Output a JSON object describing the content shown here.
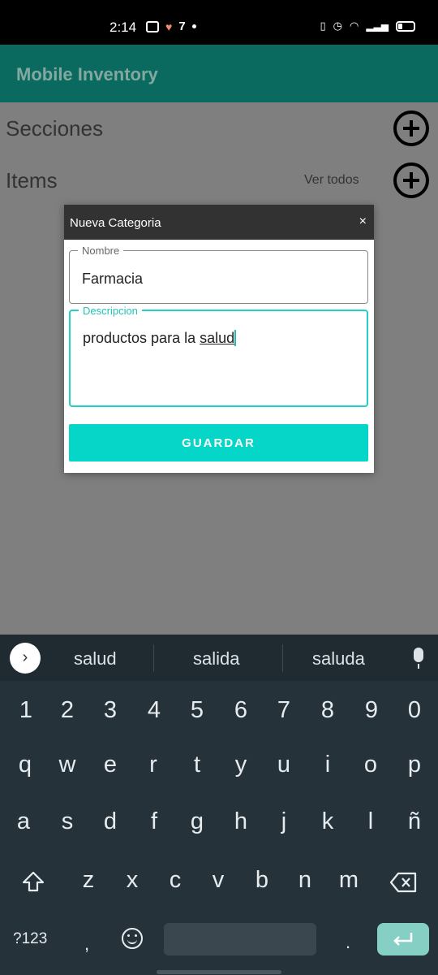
{
  "status_bar": {
    "time": "2:14"
  },
  "app": {
    "title": "Mobile Inventory",
    "sections_label": "Secciones",
    "items_label": "Items",
    "view_all": "Ver todos"
  },
  "dialog": {
    "title": "Nueva Categoria",
    "close": "×",
    "nombre_label": "Nombre",
    "nombre_value": "Farmacia",
    "descripcion_label": "Descripcion",
    "descripcion_prefix": "productos para la ",
    "descripcion_current_word": "salud",
    "save_label": "GUARDAR"
  },
  "keyboard": {
    "suggestions": [
      "salud",
      "salida",
      "saluda"
    ],
    "row_numbers": [
      "1",
      "2",
      "3",
      "4",
      "5",
      "6",
      "7",
      "8",
      "9",
      "0"
    ],
    "row1": [
      "q",
      "w",
      "e",
      "r",
      "t",
      "y",
      "u",
      "i",
      "o",
      "p"
    ],
    "row2": [
      "a",
      "s",
      "d",
      "f",
      "g",
      "h",
      "j",
      "k",
      "l",
      "ñ"
    ],
    "row3": [
      "z",
      "x",
      "c",
      "v",
      "b",
      "n",
      "m"
    ],
    "symbols_key": "?123",
    "comma": ",",
    "period": ".",
    "colors": {
      "enter": "#86cfc5",
      "background": "#26323a"
    }
  },
  "colors": {
    "accent": "#06d6c8",
    "appbar": "#0a6a5f"
  }
}
